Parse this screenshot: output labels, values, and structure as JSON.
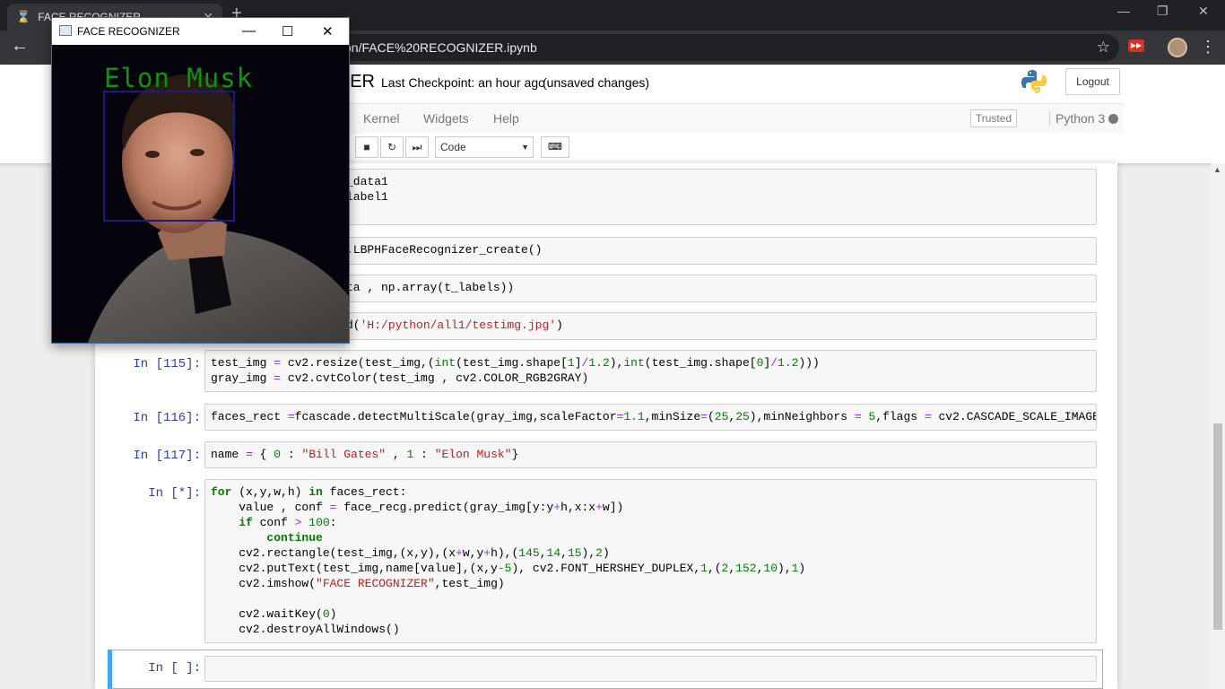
{
  "browser": {
    "tab_title": "FACE RECOGNIZER",
    "tab_close": "✕",
    "new_tab": "+",
    "url_path": "on/FACE%20RECOGNIZER.ipynb",
    "ext_label": "▶▶"
  },
  "jupyter": {
    "title_fragment": "ZER",
    "checkpoint": "Last Checkpoint: an hour ago",
    "unsaved": "(unsaved changes)",
    "logout": "Logout",
    "menu": {
      "kernel": "Kernel",
      "widgets": "Widgets",
      "help": "Help"
    },
    "trusted": "Trusted",
    "kernel_name": "Python 3",
    "cell_type": "Code",
    "accent_color": "#42a5f5",
    "prompt_color": "#303f9f"
  },
  "cells": {
    "c1_line1": "_data1",
    "c1_line2": "label1",
    "c2": ".LBPHFaceRecognizer_create()",
    "c3": "ta , np.array(t_labels))",
    "c4_a": "d(",
    "c4_b": "'H:/python/all1/testimg.jpg'",
    "c4_c": ")",
    "p115": "In [115]:",
    "p116": "In [116]:",
    "p117": "In [117]:",
    "pstar": "In [*]:",
    "pempty": "In [ ]:"
  },
  "popup": {
    "title": "FACE RECOGNIZER",
    "detected_name": "Elon Musk",
    "box_color": "#1a1a8f",
    "text_color": "#0a9802"
  }
}
